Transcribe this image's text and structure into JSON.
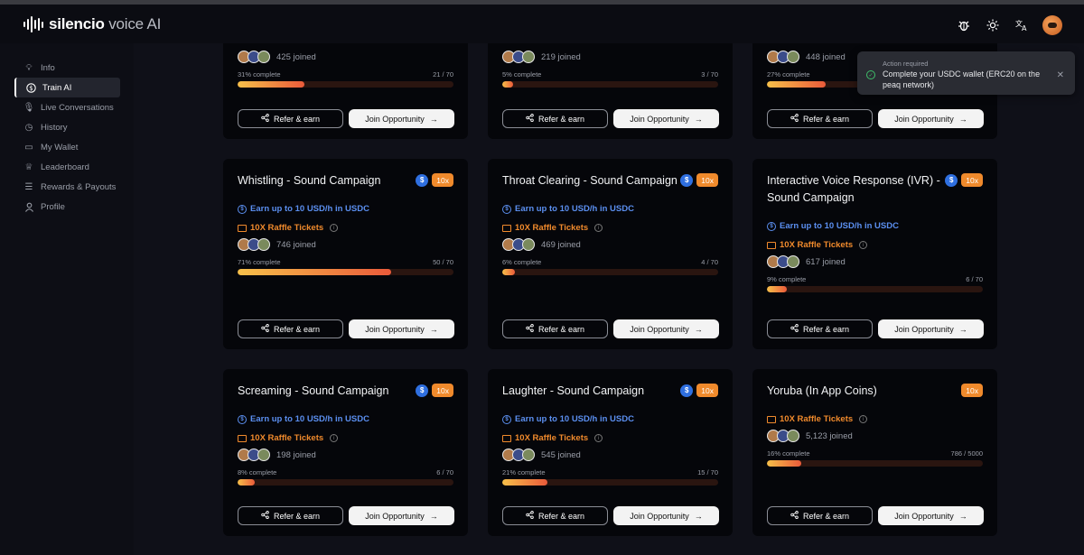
{
  "app": {
    "brand_bold": "silencio",
    "brand_rest": " voice AI"
  },
  "header": {
    "icons": [
      "bug-icon",
      "sun-icon",
      "translate-icon",
      "avatar"
    ]
  },
  "sidebar": {
    "items": [
      {
        "label": "Info",
        "icon": "lightbulb-icon",
        "active": false
      },
      {
        "label": "Train AI",
        "icon": "dollar-icon",
        "active": true
      },
      {
        "label": "Live Conversations",
        "icon": "microphone-icon",
        "active": false
      },
      {
        "label": "History",
        "icon": "clock-icon",
        "active": false
      },
      {
        "label": "My Wallet",
        "icon": "wallet-icon",
        "active": false
      },
      {
        "label": "Leaderboard",
        "icon": "trophy-icon",
        "active": false
      },
      {
        "label": "Rewards & Payouts",
        "icon": "list-icon",
        "active": false
      },
      {
        "label": "Profile",
        "icon": "user-icon",
        "active": false
      }
    ]
  },
  "toast": {
    "heading": "Action required",
    "message": "Complete your USDC wallet (ERC20 on the peaq network)"
  },
  "labels": {
    "refer": "Refer & earn",
    "join": "Join Opportunity",
    "earn": "Earn up to 10 USD/h in USDC",
    "raffle": "10X Raffle Tickets",
    "complete_suffix": "% complete",
    "usd_badge": "$",
    "multiplier_badge": "10x"
  },
  "cards": [
    {
      "title": "",
      "joined": "425 joined",
      "pct_label": "31% complete",
      "count": "21 / 70",
      "progress": 0.31
    },
    {
      "title": "",
      "joined": "219 joined",
      "pct_label": "5% complete",
      "count": "3 / 70",
      "progress": 0.05
    },
    {
      "title": "",
      "joined": "448 joined",
      "pct_label": "27% complete",
      "count": "",
      "progress": 0.27
    },
    {
      "title": "Whistling - Sound Campaign",
      "joined": "746 joined",
      "pct_label": "71% complete",
      "count": "50 / 70",
      "progress": 0.71
    },
    {
      "title": "Throat Clearing - Sound Campaign",
      "joined": "469 joined",
      "pct_label": "6% complete",
      "count": "4 / 70",
      "progress": 0.06
    },
    {
      "title": "Interactive Voice Response (IVR) - Sound Campaign",
      "joined": "617 joined",
      "pct_label": "9% complete",
      "count": "6 / 70",
      "progress": 0.09
    },
    {
      "title": "Screaming - Sound Campaign",
      "joined": "198 joined",
      "pct_label": "8% complete",
      "count": "6 / 70",
      "progress": 0.08
    },
    {
      "title": "Laughter - Sound Campaign",
      "joined": "545 joined",
      "pct_label": "21% complete",
      "count": "15 / 70",
      "progress": 0.21
    },
    {
      "title": "Yoruba (In App Coins)",
      "joined": "5,123 joined",
      "pct_label": "16% complete",
      "count": "786 / 5000",
      "progress": 0.16
    }
  ]
}
